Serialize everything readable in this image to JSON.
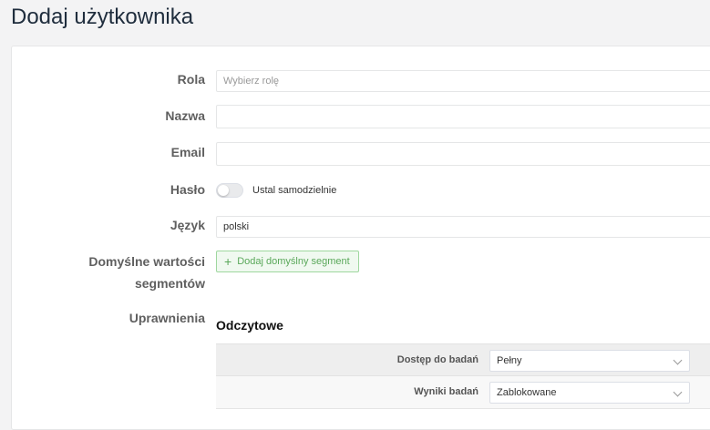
{
  "page": {
    "title": "Dodaj użytkownika"
  },
  "form": {
    "role": {
      "label": "Rola",
      "placeholder": "Wybierz rolę",
      "value": ""
    },
    "name": {
      "label": "Nazwa",
      "value": ""
    },
    "email": {
      "label": "Email",
      "value": ""
    },
    "password": {
      "label": "Hasło",
      "toggle_label": "Ustal samodzielnie",
      "toggle_on": false
    },
    "language": {
      "label": "Język",
      "value": "polski"
    },
    "default_segments": {
      "label_line1": "Domyślne wartości",
      "label_line2": "segmentów",
      "button_label": "Dodaj domyślny segment"
    },
    "permissions": {
      "label": "Uprawnienia",
      "section_title": "Odczytowe",
      "rows": [
        {
          "label": "Dostęp do badań",
          "value": "Pełny"
        },
        {
          "label": "Wyniki badań",
          "value": "Zablokowane"
        }
      ]
    }
  },
  "colors": {
    "accent_green": "#5aa85a",
    "title_color": "#1f2d3d"
  },
  "icons": {
    "plus": "plus-icon",
    "chevron": "chevron-down-icon"
  }
}
